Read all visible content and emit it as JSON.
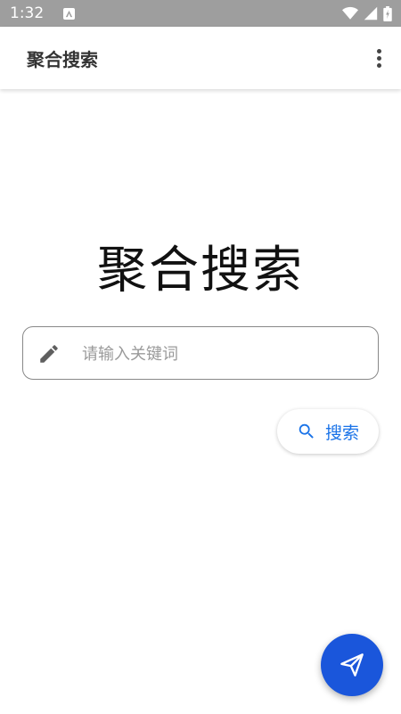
{
  "status_bar": {
    "time": "1:32",
    "notification_icon": "a-letter-icon",
    "wifi_icon": "wifi-icon",
    "signal_icon": "cell-signal-icon",
    "battery_icon": "battery-icon"
  },
  "app_bar": {
    "title": "聚合搜索",
    "menu_icon": "more-vert-icon"
  },
  "main": {
    "hero_title": "聚合搜索",
    "search_input": {
      "placeholder": "请输入关键词",
      "value": "",
      "icon": "pencil-icon"
    },
    "search_button": {
      "label": "搜索",
      "icon": "search-icon"
    }
  },
  "fab": {
    "icon": "send-icon"
  },
  "colors": {
    "status_bar_bg": "#9e9e9e",
    "accent_blue": "#1a73e8",
    "fab_blue": "#1a56db"
  }
}
